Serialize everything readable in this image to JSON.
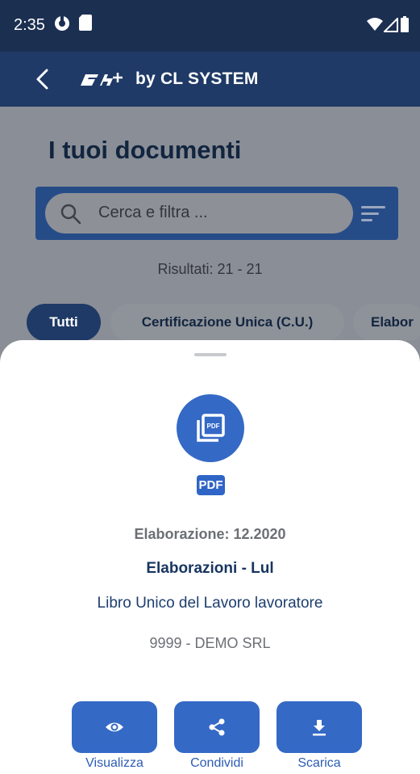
{
  "status_bar": {
    "time": "2:35"
  },
  "app_bar": {
    "brand": "by CL SYSTEM"
  },
  "page": {
    "title": "I tuoi documenti"
  },
  "search": {
    "placeholder": "Cerca e filtra ..."
  },
  "results": {
    "text": "Risultati: 21 - 21"
  },
  "tabs": [
    {
      "label": "Tutti",
      "active": true
    },
    {
      "label": "Certificazione Unica (C.U.)",
      "active": false
    },
    {
      "label": "Elabor",
      "active": false
    }
  ],
  "sheet": {
    "badge": "PDF",
    "period": "Elaborazione: 12.2020",
    "category": "Elaborazioni - Lul",
    "description": "Libro Unico del Lavoro lavoratore",
    "company": "9999 - DEMO SRL"
  },
  "actions": [
    {
      "label": "Visualizza",
      "icon": "eye-icon"
    },
    {
      "label": "Condividi",
      "icon": "share-icon"
    },
    {
      "label": "Scarica",
      "icon": "download-icon"
    }
  ],
  "colors": {
    "primary": "#1f3a66",
    "accent": "#3469c6",
    "scrim": "#8a8e96"
  }
}
